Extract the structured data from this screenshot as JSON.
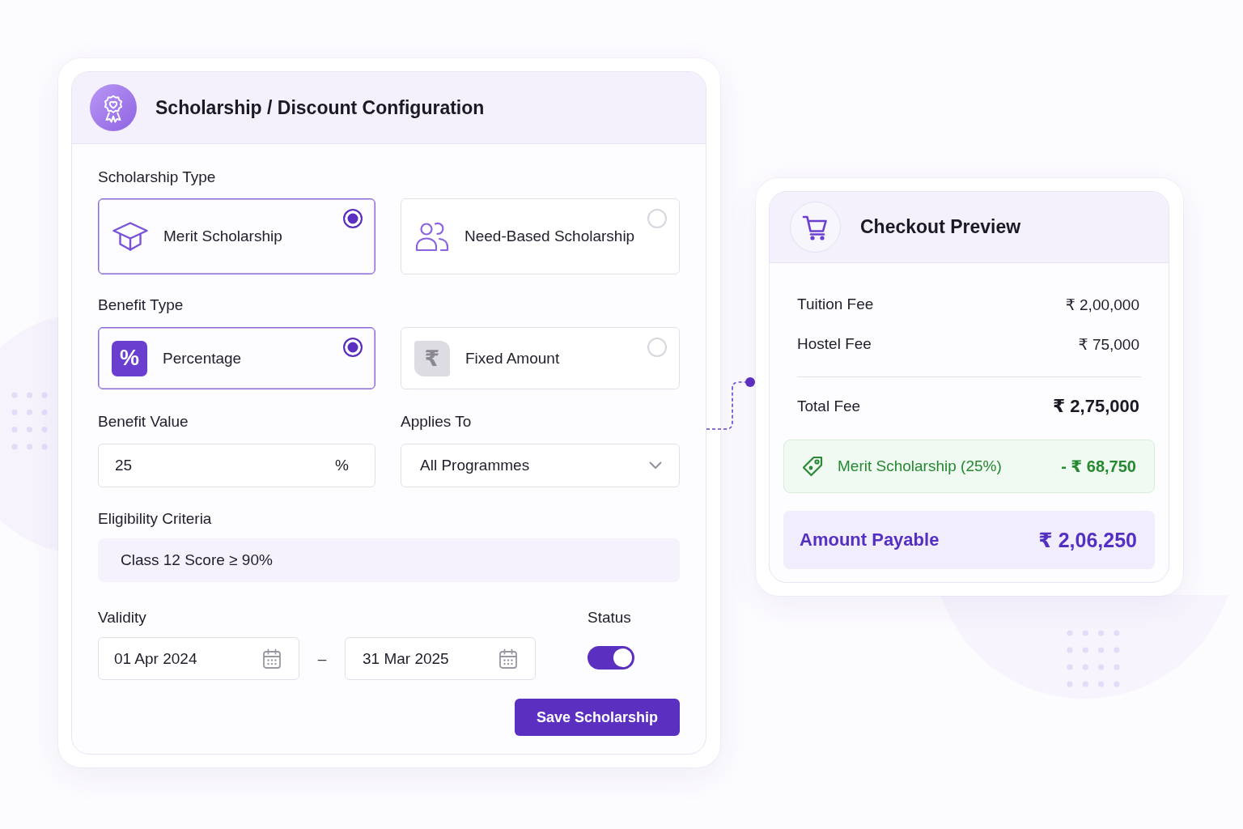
{
  "config_panel": {
    "title": "Scholarship / Discount Configuration",
    "scholarship_type": {
      "label": "Scholarship Type",
      "options": [
        {
          "kind": "merit",
          "label": "Merit Scholarship",
          "selected": true
        },
        {
          "kind": "need",
          "label": "Need-Based Scholarship",
          "selected": false
        }
      ]
    },
    "benefit_type": {
      "label": "Benefit Type",
      "options": [
        {
          "kind": "percent",
          "icon": "%",
          "label": "Percentage",
          "selected": true
        },
        {
          "kind": "fixed",
          "icon": "₹",
          "label": "Fixed Amount",
          "selected": false
        }
      ]
    },
    "benefit_value": {
      "label": "Benefit Value",
      "value": "25",
      "unit": "%"
    },
    "applies_to": {
      "label": "Applies To",
      "value": "All Programmes"
    },
    "eligibility": {
      "label": "Eligibility Criteria",
      "value": "Class 12 Score ≥ 90%"
    },
    "validity": {
      "label": "Validity",
      "from": "01 Apr 2024",
      "separator": "–",
      "to": "31 Mar 2025"
    },
    "status": {
      "label": "Status",
      "on": true
    },
    "save_button": "Save Scholarship"
  },
  "checkout_preview": {
    "title": "Checkout Preview",
    "fees": [
      {
        "label": "Tuition Fee",
        "amount": "₹ 2,00,000"
      },
      {
        "label": "Hostel Fee",
        "amount": "₹ 75,000"
      }
    ],
    "total": {
      "label": "Total Fee",
      "amount": "₹ 2,75,000"
    },
    "discount": {
      "label": "Merit Scholarship (25%)",
      "amount": "- ₹ 68,750"
    },
    "payable": {
      "label": "Amount Payable",
      "amount": "₹ 2,06,250"
    }
  }
}
